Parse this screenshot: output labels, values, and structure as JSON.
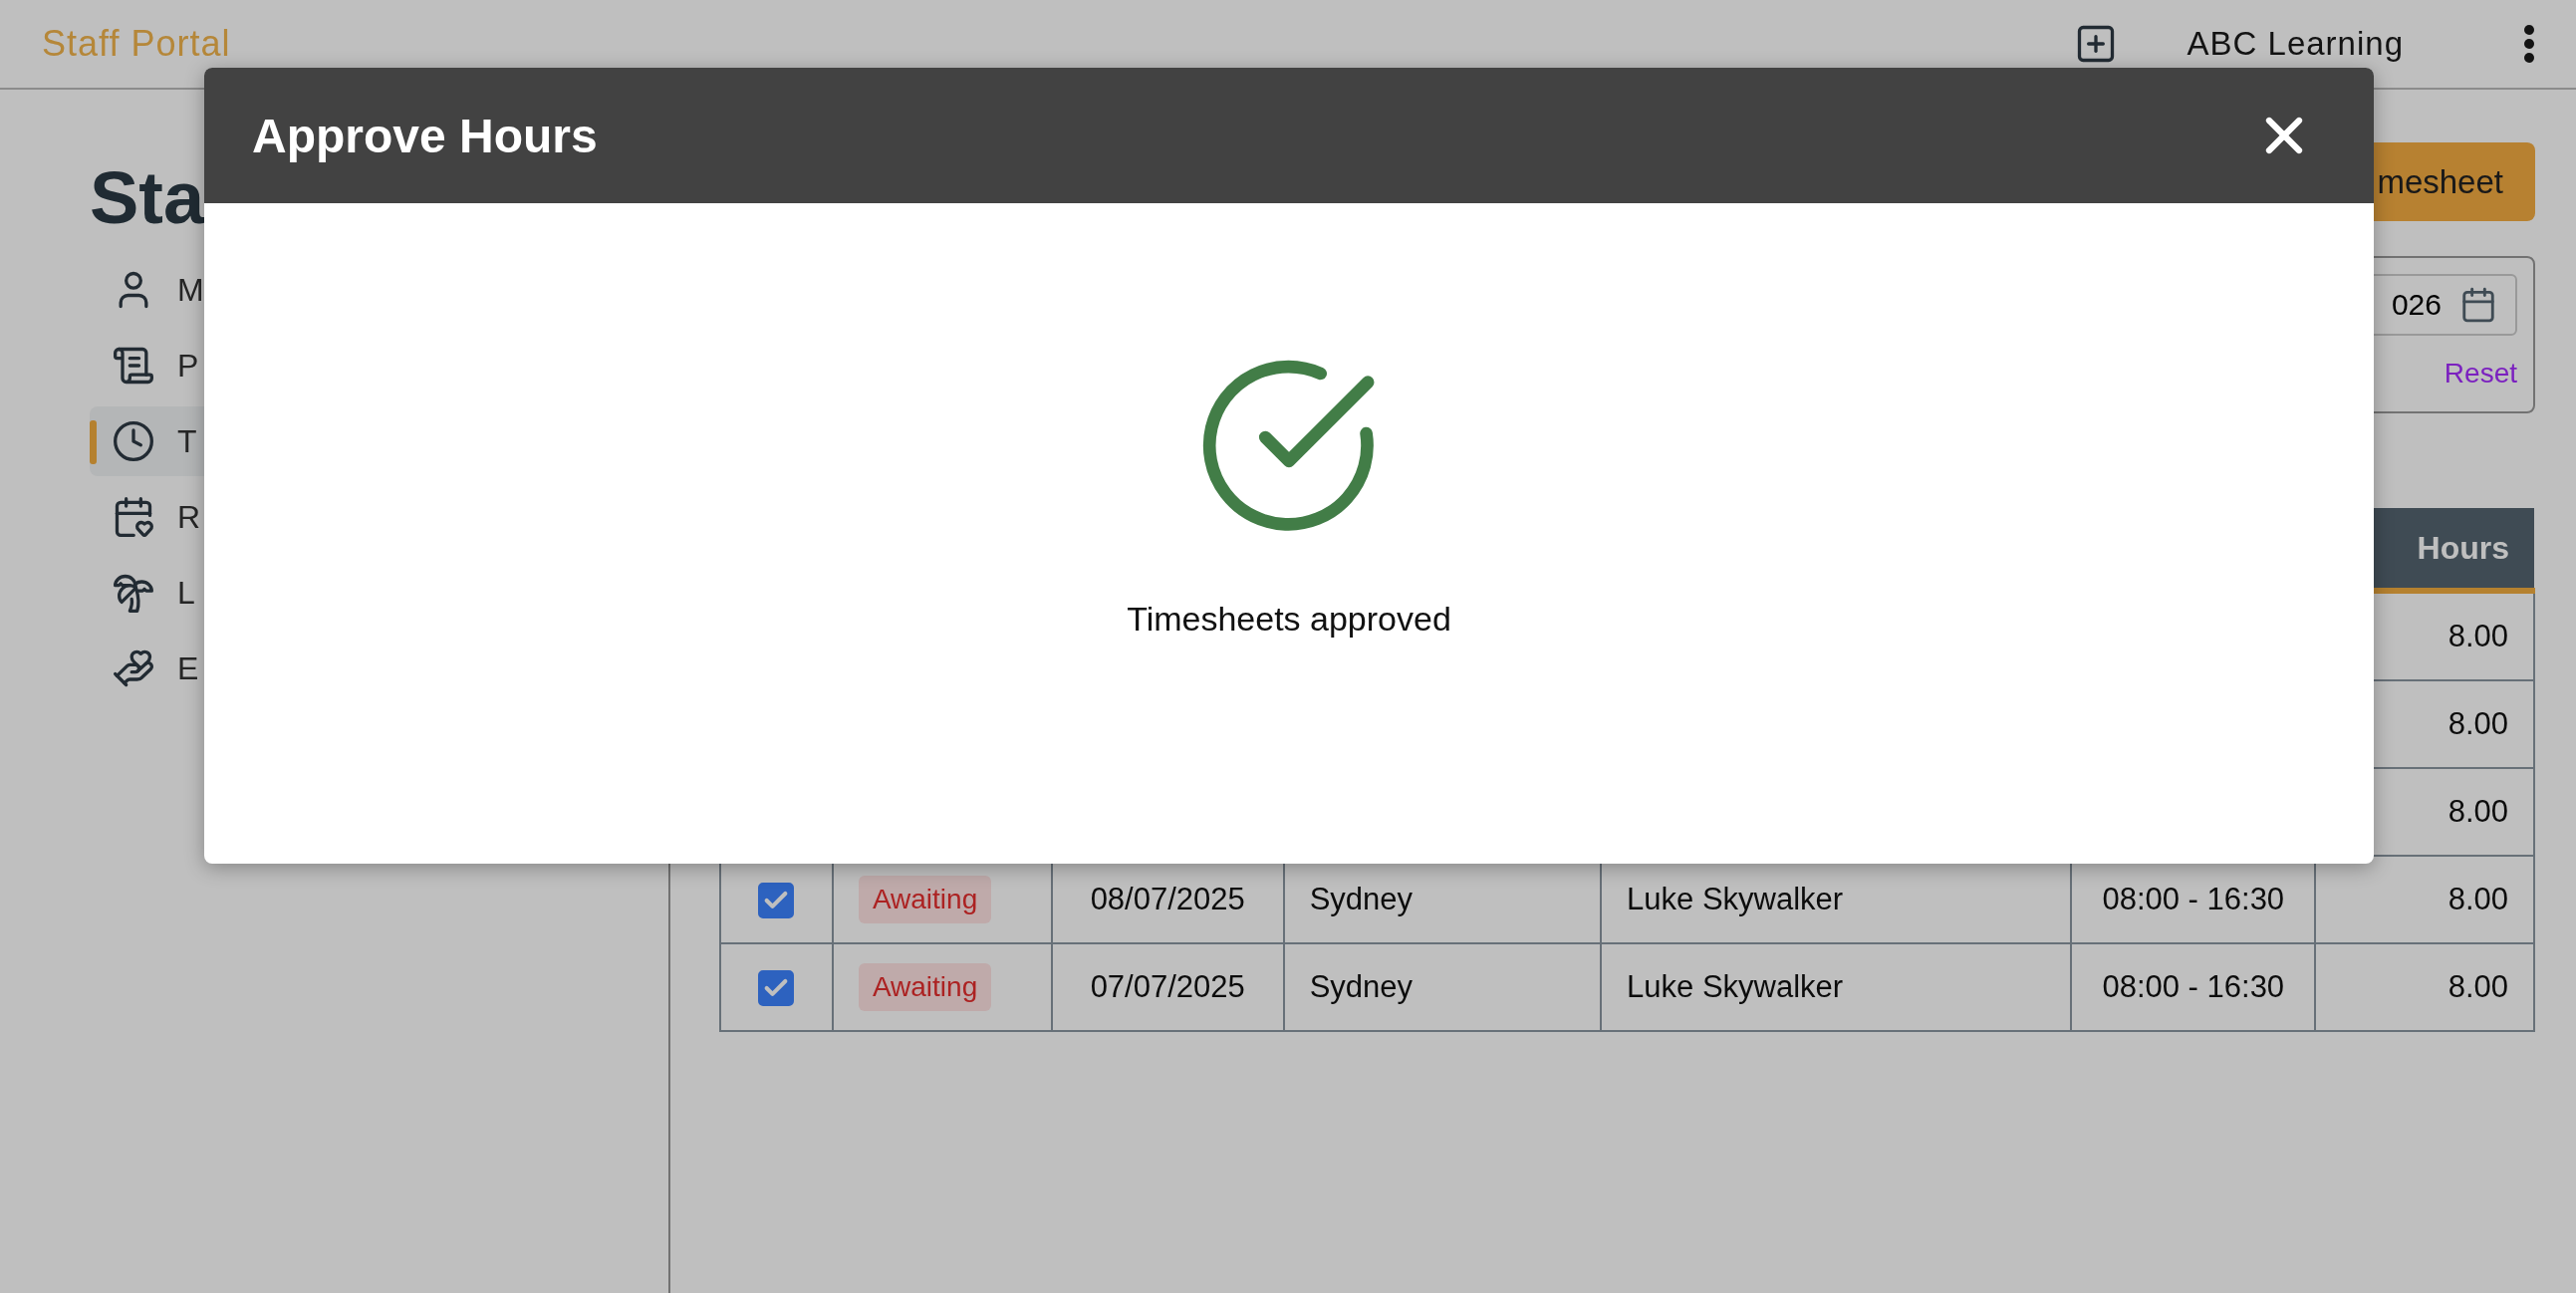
{
  "header": {
    "title": "Staff Portal",
    "org": "ABC Learning"
  },
  "sidebar": {
    "heading": "Sta",
    "items": [
      {
        "label": "M",
        "selected": false
      },
      {
        "label": "P",
        "selected": false
      },
      {
        "label": "T",
        "selected": true
      },
      {
        "label": "R",
        "selected": false
      },
      {
        "label": "L",
        "selected": false
      },
      {
        "label": "E",
        "selected": false
      }
    ]
  },
  "action_button": "mesheet",
  "filter": {
    "date_value": "026",
    "reset": "Reset"
  },
  "table": {
    "hours_header": "Hours",
    "rows": [
      {
        "hours": "8.00"
      },
      {
        "hours": "8.00"
      },
      {
        "hours": "8.00"
      },
      {
        "checked": true,
        "status": "Awaiting",
        "date": "08/07/2025",
        "location": "Sydney",
        "name": "Luke Skywalker",
        "time": "08:00 - 16:30",
        "hours": "8.00"
      },
      {
        "checked": true,
        "status": "Awaiting",
        "date": "07/07/2025",
        "location": "Sydney",
        "name": "Luke Skywalker",
        "time": "08:00 - 16:30",
        "hours": "8.00"
      }
    ]
  },
  "modal": {
    "title": "Approve Hours",
    "message": "Timesheets approved"
  }
}
